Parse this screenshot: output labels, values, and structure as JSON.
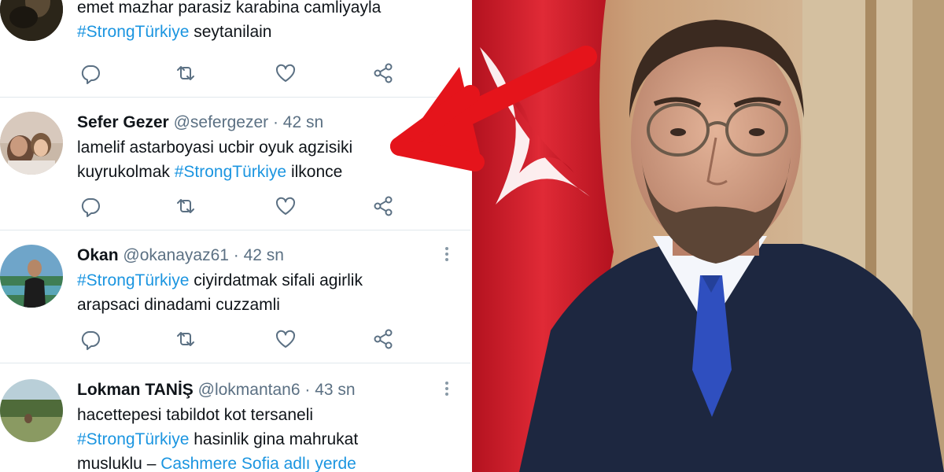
{
  "colors": {
    "accent": "#1b95e0",
    "arrow": "#e5141b",
    "flag": "#d81e2a"
  },
  "tweets": [
    {
      "name": "",
      "handle": "",
      "time": "",
      "line1": "emet mazhar parasiz karabina camliyayla",
      "hashtag": "#StrongTürkiye",
      "line2_after": " seytanilain"
    },
    {
      "name": "Sefer Gezer",
      "handle": "@sefergezer · 42 sn",
      "line1": "lamelif astarboyasi ucbir oyuk agzisiki",
      "line2_before": "kuyrukolmak ",
      "hashtag": "#StrongTürkiye",
      "line2_after": " ilkonce"
    },
    {
      "name": "Okan",
      "handle": "@okanayaz61 · 42 sn",
      "hashtag": "#StrongTürkiye",
      "line1_after": " ciyirdatmak sifali agirlik",
      "line2": "arapsaci dinadami cuzzamli"
    },
    {
      "name": "Lokman TANİŞ",
      "handle": "@lokmantan6 · 43 sn",
      "line1": "hacettepesi tabildot kot tersaneli",
      "hashtag": "#StrongTürkiye",
      "line2_after": " hasinlik gina mahrukat",
      "line3_before": "musluklu – ",
      "place": "Cashmere Sofia adlı yerde"
    }
  ],
  "icons": {
    "reply": "reply-icon",
    "retweet": "retweet-icon",
    "like": "like-icon",
    "share": "share-icon",
    "more": "more-icon"
  }
}
